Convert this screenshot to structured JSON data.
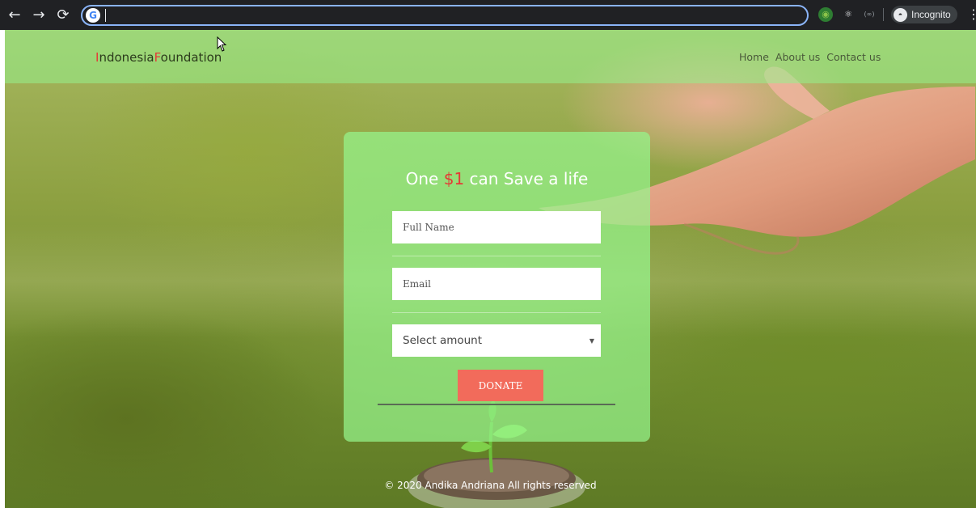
{
  "browser": {
    "back_icon": "arrow-left-icon",
    "forward_icon": "arrow-right-icon",
    "reload_icon": "reload-icon",
    "incognito_label": "Incognito",
    "address_value": ""
  },
  "site": {
    "brand_first_letter": "I",
    "brand_part1": "ndonesia",
    "brand_second_letter": "F",
    "brand_part2": "oundation",
    "nav": [
      {
        "label": "Home"
      },
      {
        "label": "About us"
      },
      {
        "label": "Contact us"
      }
    ]
  },
  "form": {
    "title_prefix": "One ",
    "title_amount": "$1",
    "title_suffix": " can Save a life",
    "name_placeholder": "Full Name",
    "email_placeholder": "Email",
    "amount_selected": "Select amount",
    "donate_label": "DONATE"
  },
  "footer": {
    "text": "© 2020 Andika Andriana All rights reserved"
  },
  "colors": {
    "accent_red": "#e53935",
    "donate_button": "#f26b5b",
    "header_overlay": "#96f08c"
  }
}
